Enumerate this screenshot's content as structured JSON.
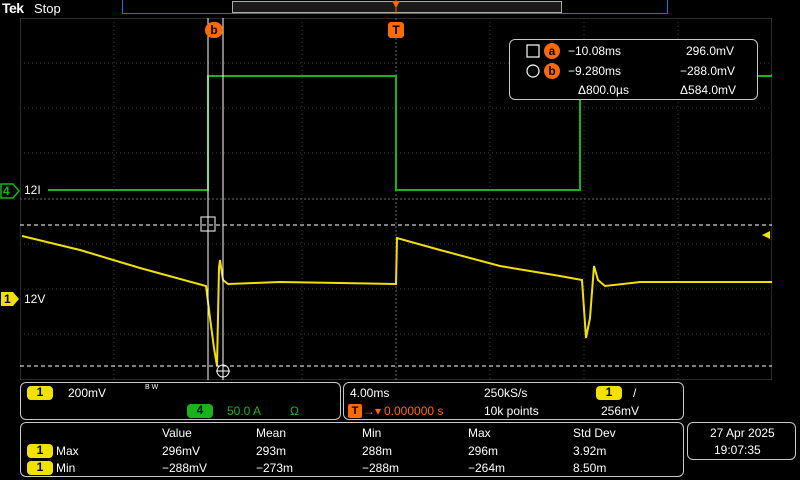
{
  "header": {
    "brand": "Tek",
    "acq_state": "Stop"
  },
  "trigger_marker": "T",
  "cursor_labels": {
    "a": "a",
    "b": "b"
  },
  "channel_markers": {
    "ch4": {
      "number": "4",
      "label": "12I"
    },
    "ch1": {
      "number": "1",
      "label": "12V"
    }
  },
  "cursor_readout": {
    "a_time": "−10.08ms",
    "a_value": "296.0mV",
    "b_time": "−9.280ms",
    "b_value": "−288.0mV",
    "delta_time": "Δ800.0µs",
    "delta_value": "Δ584.0mV"
  },
  "channel_settings": {
    "ch1": {
      "number": "1",
      "scale": "200mV",
      "bw": "B W"
    },
    "ch4": {
      "number": "4",
      "scale": "50.0 A",
      "termination": "Ω"
    }
  },
  "acquisition": {
    "timebase": "4.00ms",
    "sample_rate": "250kS/s",
    "trigger_source": "1",
    "trigger_slope": "/",
    "trigger_position": "0.000000 s",
    "record_length": "10k points",
    "trigger_level": "256mV"
  },
  "measurements": {
    "headers": [
      "Value",
      "Mean",
      "Min",
      "Max",
      "Std Dev"
    ],
    "rows": [
      {
        "channel": "1",
        "name": "Max",
        "values": [
          "296mV",
          "293m",
          "288m",
          "296m",
          "3.92m"
        ]
      },
      {
        "channel": "1",
        "name": "Min",
        "values": [
          "−288mV",
          "−273m",
          "−288m",
          "−264m",
          "8.50m"
        ]
      }
    ]
  },
  "datetime": {
    "date": "27 Apr  2025",
    "time": "19:07:35"
  },
  "colors": {
    "ch1": "#f2e100",
    "ch4": "#1bb31b",
    "cursor": "#ff6a00",
    "grid": "#444"
  }
}
